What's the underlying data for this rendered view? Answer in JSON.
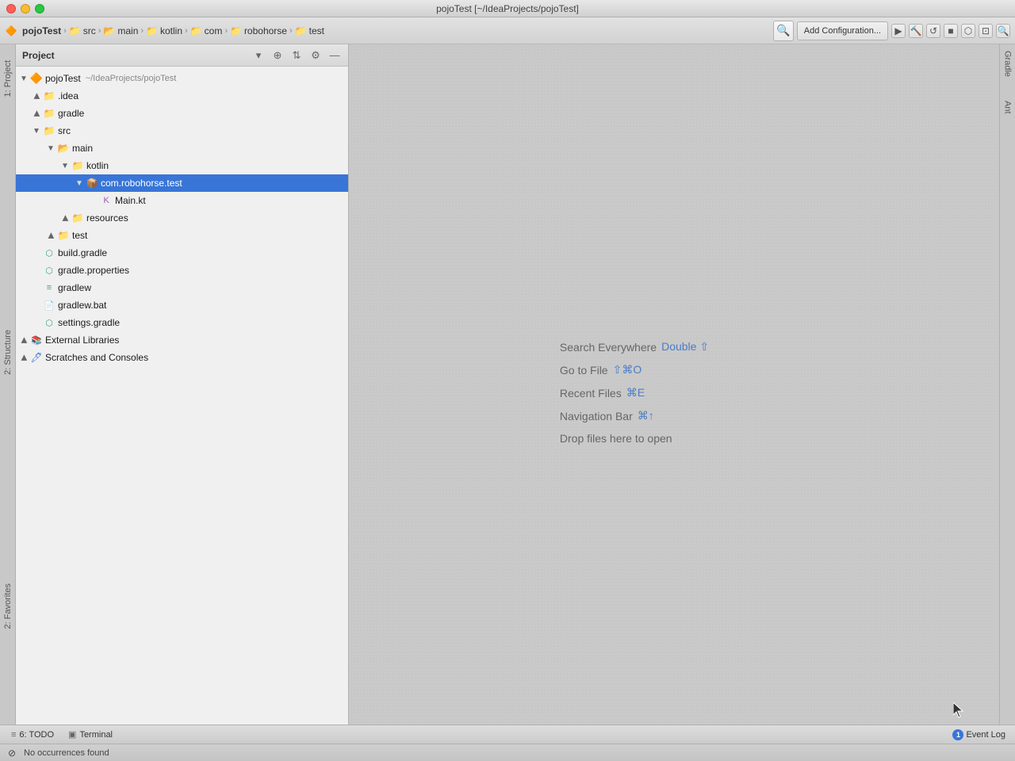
{
  "window": {
    "title": "pojoTest [~/IdeaProjects/pojoTest]"
  },
  "titlebar": {
    "close": "close",
    "minimize": "minimize",
    "maximize": "maximize",
    "title": "pojoTest [~/IdeaProjects/pojoTest]"
  },
  "toolbar": {
    "breadcrumbs": [
      {
        "label": "pojoTest",
        "type": "project"
      },
      {
        "label": "src",
        "type": "folder-blue"
      },
      {
        "label": "main",
        "type": "folder-orange"
      },
      {
        "label": "kotlin",
        "type": "folder-blue"
      },
      {
        "label": "com",
        "type": "folder-blue"
      },
      {
        "label": "robohorse",
        "type": "folder-blue"
      },
      {
        "label": "test",
        "type": "folder-blue"
      }
    ],
    "add_configuration": "Add Configuration...",
    "run_icon": "▶",
    "build_icon": "🔨",
    "rebuild_icon": "↺",
    "stop_icon": "■",
    "coverage_icon": "⬡",
    "profile_icon": "◈",
    "search_icon": "🔍"
  },
  "project_panel": {
    "title": "Project",
    "dropdown_icon": "▾",
    "add_icon": "+",
    "scroll_icon": "⇅",
    "gear_icon": "⚙",
    "close_icon": "—",
    "tree": [
      {
        "id": "pojotestroot",
        "label": "pojoTest",
        "path": "~/IdeaProjects/pojoTest",
        "depth": 0,
        "icon": "project",
        "open": true,
        "selected": false
      },
      {
        "id": "idea",
        "label": ".idea",
        "depth": 1,
        "icon": "folder",
        "open": false,
        "selected": false
      },
      {
        "id": "gradle",
        "label": "gradle",
        "depth": 1,
        "icon": "folder-blue",
        "open": false,
        "selected": false
      },
      {
        "id": "src",
        "label": "src",
        "depth": 1,
        "icon": "folder-blue",
        "open": true,
        "selected": false
      },
      {
        "id": "main",
        "label": "main",
        "depth": 2,
        "icon": "folder-orange",
        "open": true,
        "selected": false
      },
      {
        "id": "kotlin",
        "label": "kotlin",
        "depth": 3,
        "icon": "folder-blue",
        "open": true,
        "selected": false
      },
      {
        "id": "comrobohorse",
        "label": "com.robohorse.test",
        "depth": 4,
        "icon": "folder-package",
        "open": true,
        "selected": true
      },
      {
        "id": "mainkt",
        "label": "Main.kt",
        "depth": 5,
        "icon": "kotlin-file",
        "open": false,
        "selected": false
      },
      {
        "id": "resources",
        "label": "resources",
        "depth": 3,
        "icon": "folder-res",
        "open": false,
        "selected": false
      },
      {
        "id": "test",
        "label": "test",
        "depth": 2,
        "icon": "folder-test",
        "open": false,
        "selected": false
      },
      {
        "id": "buildgradle",
        "label": "build.gradle",
        "depth": 1,
        "icon": "gradle-file",
        "open": false,
        "selected": false
      },
      {
        "id": "gradleprops",
        "label": "gradle.properties",
        "depth": 1,
        "icon": "gradle-props",
        "open": false,
        "selected": false
      },
      {
        "id": "gradlew",
        "label": "gradlew",
        "depth": 1,
        "icon": "script",
        "open": false,
        "selected": false
      },
      {
        "id": "gradlewbat",
        "label": "gradlew.bat",
        "depth": 1,
        "icon": "bat-file",
        "open": false,
        "selected": false
      },
      {
        "id": "settingsgradle",
        "label": "settings.gradle",
        "depth": 1,
        "icon": "gradle-file",
        "open": false,
        "selected": false
      },
      {
        "id": "external",
        "label": "External Libraries",
        "depth": 0,
        "icon": "lib",
        "open": false,
        "selected": false
      },
      {
        "id": "scratches",
        "label": "Scratches and Consoles",
        "depth": 0,
        "icon": "scratch",
        "open": false,
        "selected": false
      }
    ]
  },
  "editor": {
    "hints": [
      {
        "text": "Search Everywhere",
        "shortcut": "Double ⇧",
        "shortcut_color": "#4a7cc7"
      },
      {
        "text": "Go to File",
        "shortcut": "⇧⌘O",
        "shortcut_color": "#4a7cc7"
      },
      {
        "text": "Recent Files",
        "shortcut": "⌘E",
        "shortcut_color": "#4a7cc7"
      },
      {
        "text": "Navigation Bar",
        "shortcut": "⌘↑",
        "shortcut_color": "#4a7cc7"
      },
      {
        "text": "Drop files here to open",
        "shortcut": "",
        "shortcut_color": ""
      }
    ]
  },
  "right_strip": {
    "gradle_label": "Gradle",
    "ant_label": "Ant"
  },
  "left_strip": {
    "project_label": "1: Project",
    "structure_label": "2: Structure",
    "favorites_label": "2: Favorites"
  },
  "bottom_bar": {
    "todo_label": "6: TODO",
    "terminal_label": "Terminal",
    "event_log_label": "Event Log",
    "event_count": "1",
    "status_text": "No occurrences found"
  }
}
